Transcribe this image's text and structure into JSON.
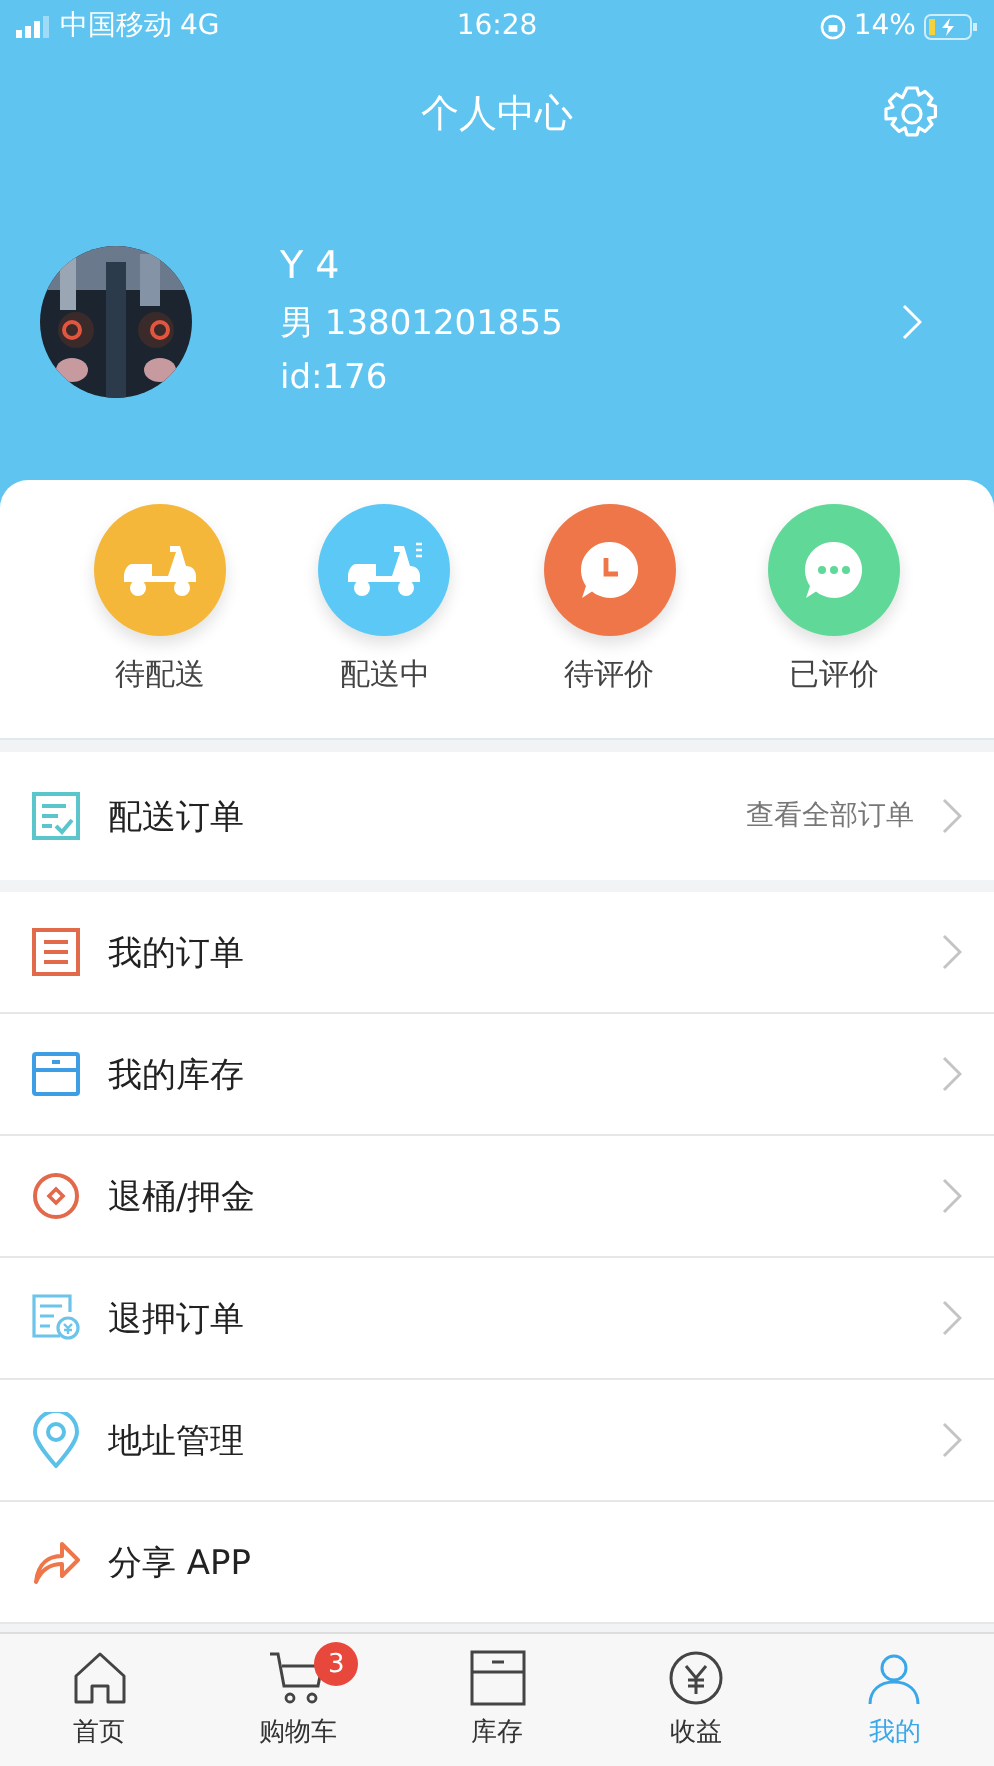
{
  "status_bar": {
    "carrier": "中国移动",
    "network": "4G",
    "time": "16:28",
    "battery": "14%"
  },
  "header": {
    "title": "个人中心"
  },
  "profile": {
    "name": "Y 4",
    "gender_phone": "男 13801201855",
    "id": "id:176"
  },
  "order_status": [
    {
      "label": "待配送",
      "kind": "scooter",
      "color": "#f4b73a"
    },
    {
      "label": "配送中",
      "kind": "scooter_moving",
      "color": "#5cc8f5"
    },
    {
      "label": "待评价",
      "kind": "clock",
      "color": "#ee7648"
    },
    {
      "label": "已评价",
      "kind": "chat",
      "color": "#5fd898"
    }
  ],
  "delivery_orders": {
    "label": "配送订单",
    "link": "查看全部订单"
  },
  "menu": [
    {
      "label": "我的订单",
      "kind": "list"
    },
    {
      "label": "我的库存",
      "kind": "box"
    },
    {
      "label": "退桶/押金",
      "kind": "coin"
    },
    {
      "label": "退押订单",
      "kind": "refund"
    },
    {
      "label": "地址管理",
      "kind": "location"
    },
    {
      "label": "分享 APP",
      "kind": "share"
    }
  ],
  "tab_bar": [
    {
      "label": "首页",
      "kind": "home",
      "selected": false
    },
    {
      "label": "购物车",
      "kind": "cart",
      "selected": false,
      "badge": "3"
    },
    {
      "label": "库存",
      "kind": "box",
      "selected": false
    },
    {
      "label": "收益",
      "kind": "yen",
      "selected": false
    },
    {
      "label": "我的",
      "kind": "person",
      "selected": true
    }
  ]
}
